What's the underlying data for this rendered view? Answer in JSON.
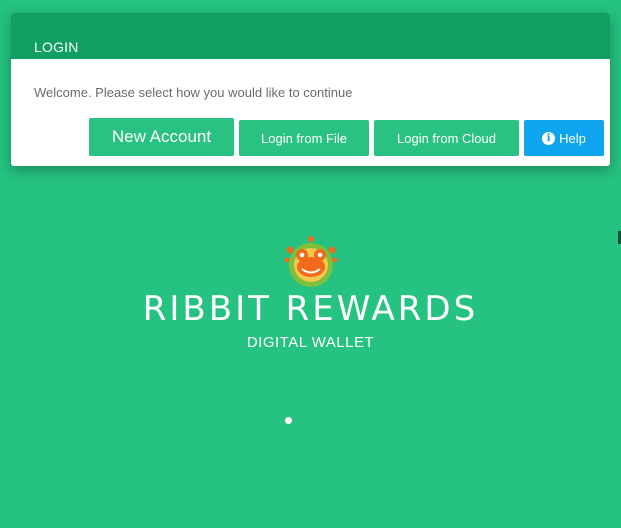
{
  "modal": {
    "title": "LOGIN",
    "welcome_text": "Welcome. Please select how you would like to continue",
    "buttons": {
      "new_account": "New Account",
      "login_file": "Login from File",
      "login_cloud": "Login from Cloud",
      "help": "Help"
    }
  },
  "splash": {
    "brand": "RIBBIT REWARDS",
    "tagline": "DIGITAL WALLET",
    "logo_icon": "frog-logo-icon",
    "loader_icon": "loading-dot-icon"
  },
  "colors": {
    "background": "#25c281",
    "header": "#0fa061",
    "button": "#2ac282",
    "help_button": "#0ea5ee"
  }
}
